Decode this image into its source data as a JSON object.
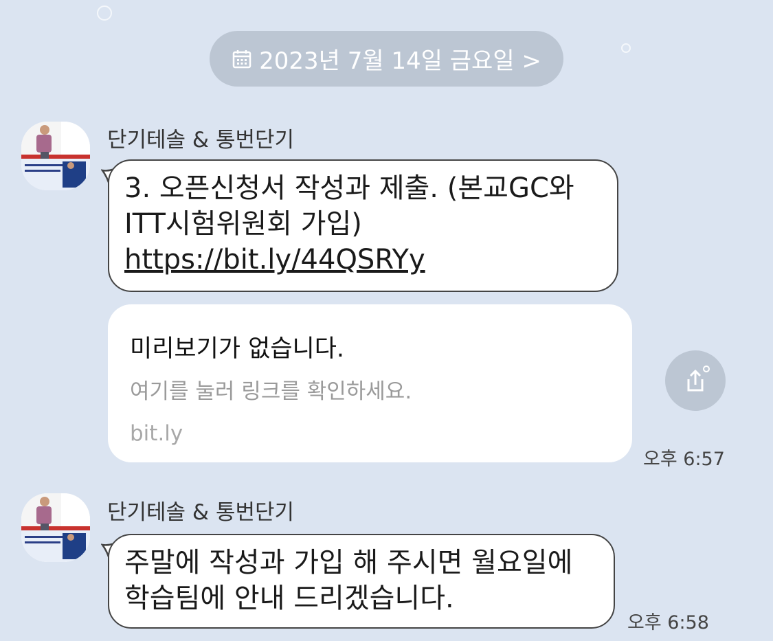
{
  "date_divider": {
    "label": "2023년 7월 14일 금요일 >",
    "icon": "calendar-icon"
  },
  "messages": [
    {
      "sender": "단기테솔 & 통번단기",
      "lines": [
        "3. 오픈신청서 작성과 제출. (본교GC와",
        "ITT시험위원회 가입)"
      ],
      "link": "https://bit.ly/44QSRYy",
      "preview": {
        "title": "미리보기가 없습니다.",
        "subtitle": "여기를 눌러 링크를 확인하세요.",
        "domain": "bit.ly"
      },
      "time": "오후 6:57"
    },
    {
      "sender": "단기테솔 & 통번단기",
      "lines": [
        "주말에 작성과 가입 해 주시면 월요일에",
        "학습팀에 안내 드리겠습니다."
      ],
      "time": "오후 6:58"
    }
  ],
  "colors": {
    "background": "#dbe4f1",
    "pill": "#bcc6d3",
    "bubble": "#ffffff"
  },
  "share_icon": "share-icon"
}
